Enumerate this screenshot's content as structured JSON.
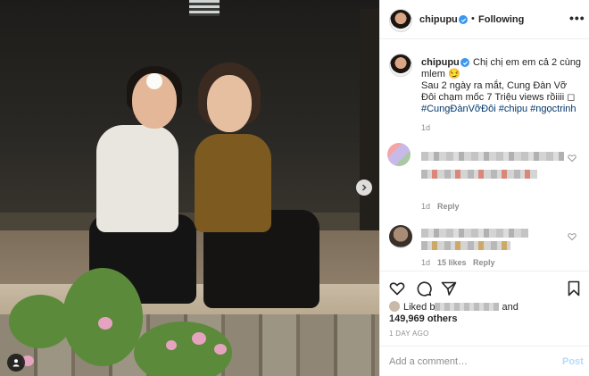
{
  "post": {
    "author": "chipupu",
    "header_sep": "•",
    "follow_status": "Following",
    "more_menu": "•••",
    "caption": {
      "line1": "Chị chị em em cả 2 cùng mlem 😏",
      "line2": "Sau 2 ngày ra mắt, Cung Đàn Vỡ Đôi chạm mốc 7 Triệu views rồiiii ◻",
      "hashtags": "#CungĐànVỡĐôi #chipu #ngọctrinh"
    },
    "caption_time": "1d",
    "comments": [
      {
        "time": "1d",
        "reply_label": "Reply",
        "likes": ""
      },
      {
        "time": "1d",
        "likes": "15 likes",
        "reply_label": "Reply"
      }
    ],
    "liked_by_prefix": "Liked b",
    "liked_by_and": "and",
    "likes_count": "149,969 others",
    "date": "1 DAY AGO",
    "add_comment_placeholder": "Add a comment…",
    "post_button": "Post"
  },
  "icons": {
    "verified": "verified-badge-icon",
    "next": "chevron-right-icon",
    "tag": "user-tag-icon",
    "like": "heart-icon",
    "comment": "comment-bubble-icon",
    "share": "paper-plane-icon",
    "save": "bookmark-icon"
  },
  "colors": {
    "verified_blue": "#3897f0",
    "hashtag_blue": "#00376b",
    "post_button_disabled": "#b3dbff",
    "muted_text": "#8e8e8e"
  }
}
